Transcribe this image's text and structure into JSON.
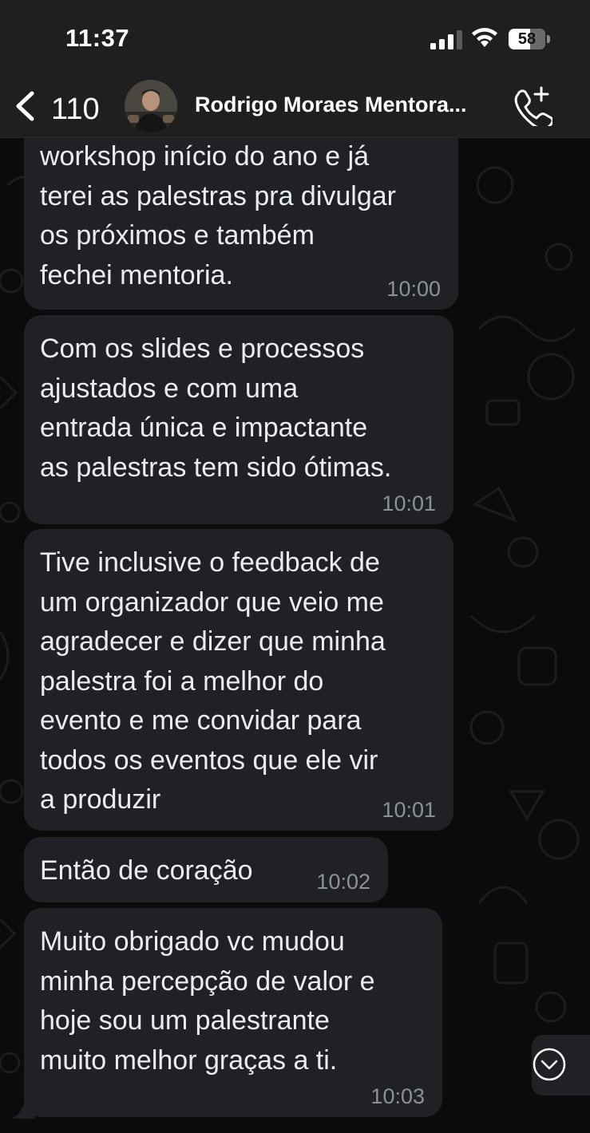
{
  "status_bar": {
    "time": "11:37",
    "battery_level": "58",
    "battery_fraction": 0.58,
    "icons": [
      "signal-icon",
      "wifi-icon",
      "battery-icon"
    ]
  },
  "header": {
    "back_count": "110",
    "contact_name": "Rodrigo Moraes Mentora...",
    "icons": [
      "chevron-left-icon",
      "add-call-icon"
    ]
  },
  "messages": [
    {
      "text": "workshop início do ano e já\nterei as palestras pra divulgar\nos próximos e também\nfechei mentoria.",
      "time": "10:00"
    },
    {
      "text": "Com os slides e processos\najustados e com uma\nentrada única e impactante\nas palestras tem sido ótimas.",
      "time": "10:01"
    },
    {
      "text": "Tive inclusive o feedback de\num organizador que veio me\nagradecer e dizer que minha\npalestra foi a melhor do\nevento e me convidar para\ntodos os eventos que ele vir\na produzir",
      "time": "10:01"
    },
    {
      "text": "Então de coração",
      "time": "10:02"
    },
    {
      "text": "Muito obrigado vc mudou\nminha percepção de valor e\nhoje sou um palestrante\nmuito melhor graças a ti.",
      "time": "10:03"
    }
  ],
  "colors": {
    "background": "#0b0b0b",
    "header": "#1f1f1f",
    "bubble": "#202124",
    "text": "#e9edef",
    "timestamp": "#8b9296"
  }
}
